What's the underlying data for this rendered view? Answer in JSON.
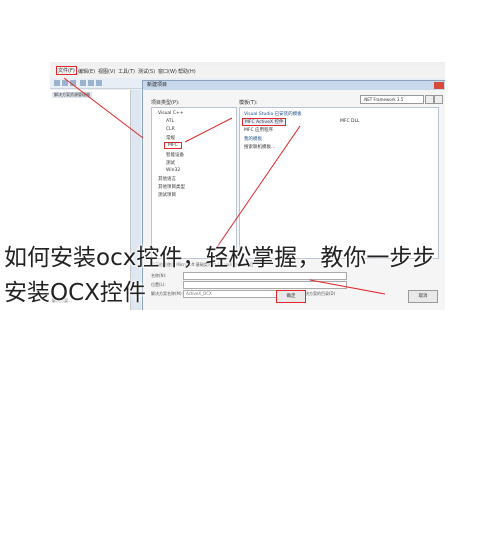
{
  "menubar": {
    "items": [
      "文件(F)",
      "编辑(E)",
      "视图(V)",
      "工具(T)",
      "测试(S)",
      "窗口(W)",
      "帮助(H)"
    ]
  },
  "left_pane": {
    "tab": "解决方案资源管理器",
    "bottom_tab": "解决方案..."
  },
  "dialog": {
    "title": "新建项目",
    "section_left": "项目类型(P):",
    "section_right": "模板(T):",
    "framework": ".NET Framework 3.5",
    "tree_items": [
      "Visual C++",
      "ATL",
      "CLR",
      "常规",
      "MFC",
      "智能设备",
      "测试",
      "Win32",
      "其他语言",
      "其他项目类型",
      "测试项目"
    ],
    "templates_header": "Visual Studio 已安装的模板",
    "templates": [
      "MFC ActiveX 控件",
      "MFC 应用程序",
      "MFC DLL"
    ],
    "my_templates_header": "我的模板",
    "my_templates": [
      "搜索联机模板..."
    ],
    "description": "用于创建使用 Microsoft 基础类库的 ActiveX 控件的项目",
    "field_labels": [
      "名称(N):",
      "位置(L):",
      "解决方案名称(M):"
    ],
    "field_values": [
      "",
      "",
      "ActiveX_OCX"
    ],
    "checkbox_label": "创建解决方案的目录(D)",
    "ok_label": "确定",
    "cancel_label": "取消"
  },
  "caption": {
    "line1": "如何安装ocx控件，轻松掌握，教你一步步",
    "line2": "安装OCX控件"
  },
  "colors": {
    "highlight": "#e0282c",
    "title_bar": "#c9d9ec"
  }
}
